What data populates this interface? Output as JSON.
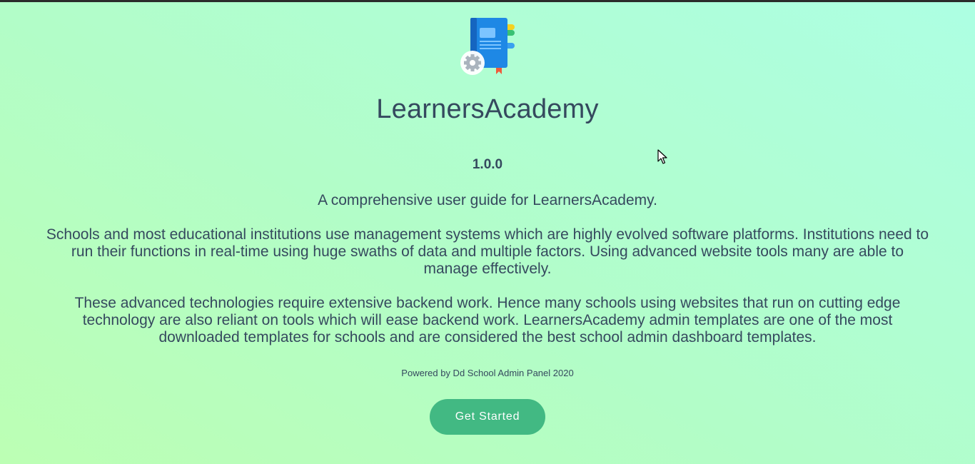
{
  "app": {
    "title": "LearnersAcademy",
    "version": "1.0.0",
    "tagline": "A comprehensive user guide for LearnersAcademy.",
    "logo_icon": "book-gear-icon"
  },
  "content": {
    "paragraphs": [
      "Schools and most educational institutions use management systems which are highly evolved software platforms. Institutions need to run their functions in real-time using huge swaths of data and multiple factors. Using advanced website tools many are able to manage effectively.",
      "These advanced technologies require extensive backend work. Hence many schools using websites that run on cutting edge technology are also reliant on tools which will ease backend work. LearnersAcademy admin templates are one of the most downloaded templates for schools and are considered the best school admin dashboard templates."
    ],
    "powered_by": "Powered by Dd School Admin Panel 2020"
  },
  "actions": {
    "get_started_label": "Get Started"
  },
  "colors": {
    "accent": "#42b983",
    "text": "#35495e",
    "background_start": "#bcffb4",
    "background_end": "#adffe3"
  }
}
